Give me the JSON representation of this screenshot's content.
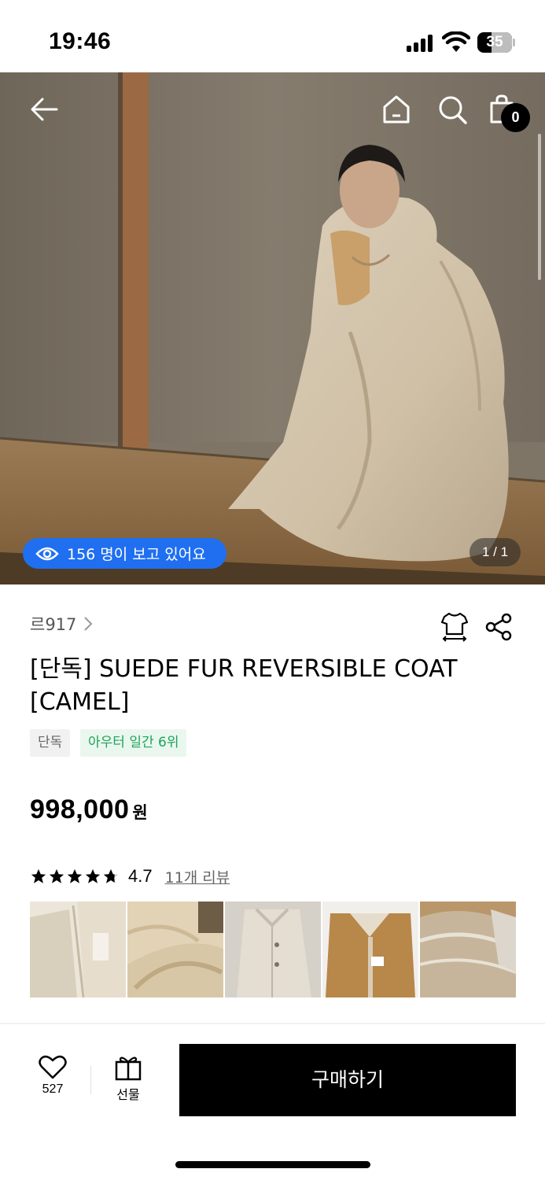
{
  "status_bar": {
    "time": "19:46",
    "battery": "35",
    "icons": [
      "signal-icon",
      "wifi-icon",
      "battery-icon"
    ]
  },
  "header": {
    "icons": [
      "back-arrow-icon",
      "home-icon",
      "search-icon",
      "cart-icon"
    ],
    "cart_count": "0"
  },
  "hero": {
    "viewers_text": "156 명이 보고 있어요",
    "page_indicator": "1 / 1",
    "image_subject": "model wearing fur coat"
  },
  "product": {
    "brand": "르917",
    "title": "[단독] SUEDE FUR REVERSIBLE COAT [CAMEL]",
    "tags": [
      "단독",
      "아우터 일간 6위"
    ],
    "price": "998,000",
    "currency": "원",
    "rating": "4.7",
    "stars": 4.7,
    "review_link": "11개 리뷰"
  },
  "bottom_bar": {
    "like_count": "527",
    "gift_label": "선물",
    "buy_label": "구매하기"
  },
  "colors": {
    "accent_blue": "#1f6ff0",
    "rank_green": "#1fa35a",
    "buy_button": "#000000"
  }
}
